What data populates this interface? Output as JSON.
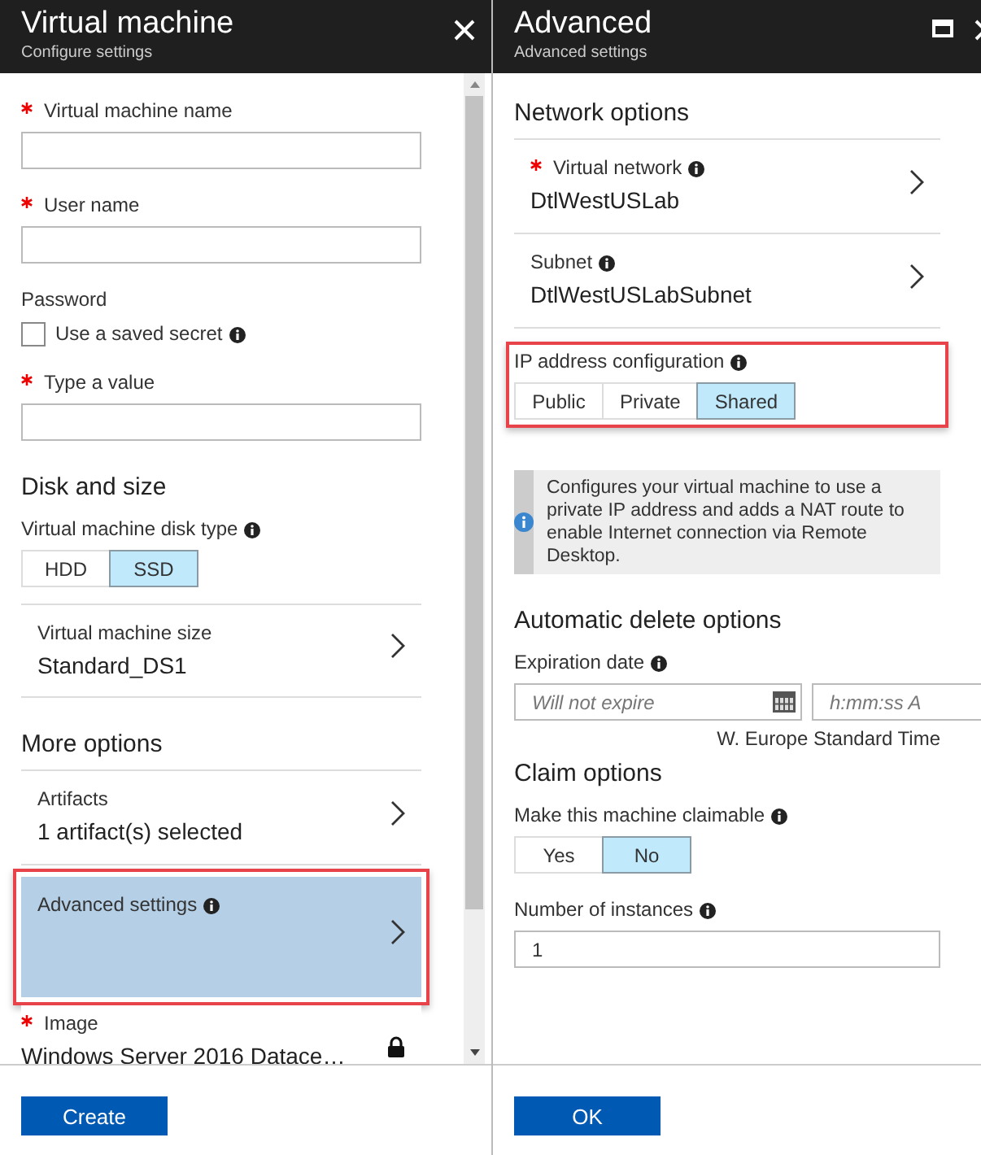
{
  "panels": [
    {
      "title": "Virtual machine",
      "subtitle": "Configure settings",
      "close": true,
      "scrollbar": true,
      "button": "Create",
      "items": [
        {
          "kind": "input",
          "label": "Virtual machine name",
          "required": true
        },
        {
          "kind": "input",
          "label": "User name",
          "required": true
        },
        {
          "kind": "label",
          "label": "Password"
        },
        {
          "kind": "checkbox",
          "label": "Use a saved secret",
          "info": true,
          "checked": false
        },
        {
          "kind": "input",
          "label": "Type a value",
          "required": true
        },
        {
          "kind": "heading",
          "label": "Disk and size"
        },
        {
          "kind": "toggle",
          "label": "Virtual machine disk type",
          "info": true,
          "options": [
            {
              "label": "HDD",
              "selected": false
            },
            {
              "label": "SSD",
              "selected": true
            }
          ]
        },
        {
          "kind": "nav",
          "label": "Virtual machine size",
          "value": "Standard_DS1",
          "selected": false
        },
        {
          "kind": "heading",
          "label": "More options",
          "rule": true
        },
        {
          "kind": "nav",
          "label": "Artifacts",
          "value": "1 artifact(s) selected",
          "selected": false
        },
        {
          "kind": "nav",
          "label": "Advanced settings",
          "info": true,
          "selected": true,
          "highlighted": true
        },
        {
          "kind": "locked",
          "label": "Image",
          "required": true,
          "value": "Windows Server 2016 Datace…"
        }
      ]
    },
    {
      "title": "Advanced",
      "subtitle": "Advanced settings",
      "maximize": true,
      "close": true,
      "button": "OK",
      "items": [
        {
          "kind": "heading",
          "label": "Network options",
          "rule": true
        },
        {
          "kind": "nav",
          "label": "Virtual network",
          "required": true,
          "info": true,
          "value": "DtlWestUSLab",
          "selected": false
        },
        {
          "kind": "nav",
          "label": "Subnet",
          "info": true,
          "value": "DtlWestUSLabSubnet",
          "selected": false
        },
        {
          "kind": "toggle",
          "label": "IP address configuration",
          "info": true,
          "highlighted": true,
          "options": [
            {
              "label": "Public",
              "selected": false
            },
            {
              "label": "Private",
              "selected": false
            },
            {
              "label": "Shared",
              "selected": true
            }
          ]
        },
        {
          "kind": "note",
          "text": "Configures your virtual machine to use a private IP address and adds a NAT route to enable Internet connection via Remote Desktop."
        },
        {
          "kind": "heading",
          "label": "Automatic delete options"
        },
        {
          "kind": "datetime",
          "label": "Expiration date",
          "info": true,
          "date_placeholder": "Will not expire",
          "time_placeholder": "h:mm:ss A",
          "timezone": "W. Europe Standard Time"
        },
        {
          "kind": "heading",
          "label": "Claim options"
        },
        {
          "kind": "toggle",
          "label": "Make this machine claimable",
          "info": true,
          "options": [
            {
              "label": "Yes",
              "selected": false
            },
            {
              "label": "No",
              "selected": true
            }
          ]
        },
        {
          "kind": "input",
          "label": "Number of instances",
          "info": true,
          "value": "1"
        }
      ]
    }
  ]
}
